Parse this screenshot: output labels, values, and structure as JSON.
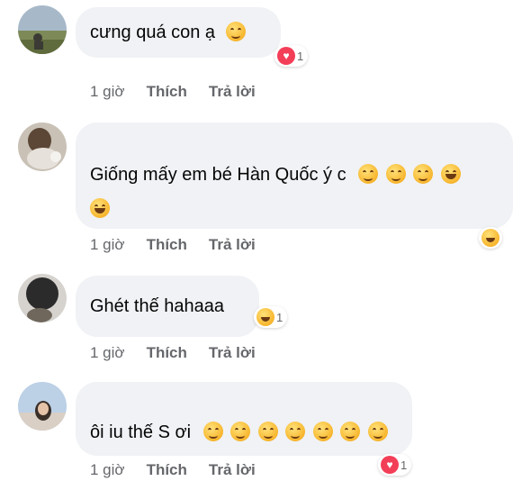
{
  "comments": [
    {
      "text": "cưng quá con ạ",
      "time": "1 giờ",
      "like": "Thích",
      "reply": "Trả lời",
      "reaction_count": "1",
      "reaction_icon": "heart-icon"
    },
    {
      "text": "Giống mấy em bé Hàn Quốc ý c",
      "time": "1 giờ",
      "like": "Thích",
      "reply": "Trả lời",
      "reaction_icon": "laughing-icon"
    },
    {
      "text": "Ghét thế hahaaa",
      "time": "1 giờ",
      "like": "Thích",
      "reply": "Trả lời",
      "reaction_count": "1",
      "reaction_icon": "laughing-icon"
    },
    {
      "text": "ôi iu thế S ơi",
      "time": "1 giờ",
      "like": "Thích",
      "reply": "Trả lời",
      "reaction_count": "1",
      "reaction_icon": "heart-icon"
    }
  ],
  "colors": {
    "bubble": "#f0f2f5",
    "meta_text": "#65676b",
    "heart": "#f33e58",
    "emoji_yellow": "#f7b52c"
  }
}
